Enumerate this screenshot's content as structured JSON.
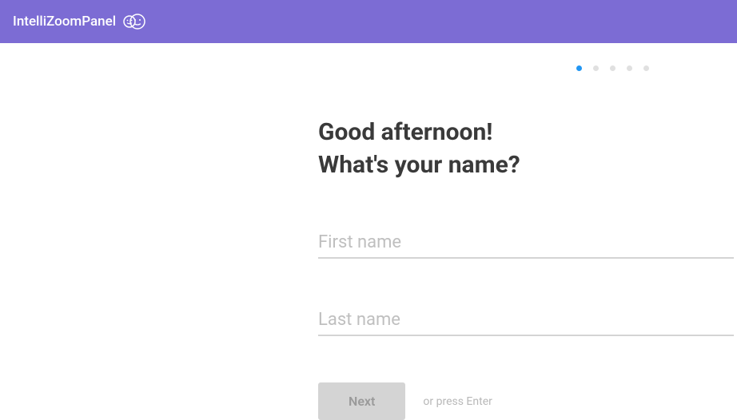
{
  "header": {
    "brand": "IntelliZoomPanel"
  },
  "progress": {
    "total": 5,
    "active_index": 0
  },
  "form": {
    "greeting_line1": "Good afternoon!",
    "greeting_line2": "What's your name?",
    "first_name": {
      "value": "",
      "placeholder": "First name"
    },
    "last_name": {
      "value": "",
      "placeholder": "Last name"
    },
    "next_label": "Next",
    "hint": "or press Enter"
  }
}
